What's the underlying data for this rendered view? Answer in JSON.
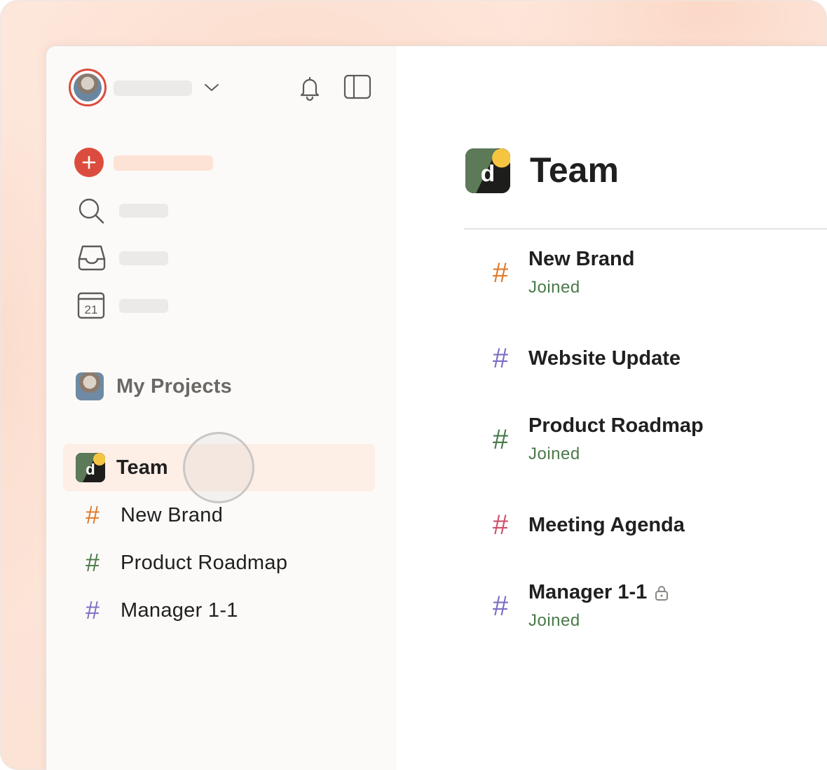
{
  "sidebar": {
    "projects_header": "My Projects",
    "team": {
      "label": "Team"
    },
    "team_projects": [
      {
        "label": "New Brand",
        "color": "#e07a2c"
      },
      {
        "label": "Product Roadmap",
        "color": "#4a7a4a"
      },
      {
        "label": "Manager 1-1",
        "color": "#7c6fc4"
      }
    ],
    "icons": {
      "add": "plus-icon",
      "search": "search-icon",
      "inbox": "inbox-icon",
      "calendar": "calendar-icon",
      "calendar_day": "21",
      "notifications": "bell-icon",
      "toggle_sidebar": "sidebar-toggle-icon"
    },
    "accent": "#dc4c3e"
  },
  "main": {
    "title": "Team",
    "projects": [
      {
        "name": "New Brand",
        "status": "Joined",
        "color": "#e07a2c",
        "locked": false
      },
      {
        "name": "Website Update",
        "status": "",
        "color": "#7c6fc4",
        "locked": false
      },
      {
        "name": "Product Roadmap",
        "status": "Joined",
        "color": "#4a7a4a",
        "locked": false
      },
      {
        "name": "Meeting Agenda",
        "status": "",
        "color": "#d0506a",
        "locked": false
      },
      {
        "name": "Manager 1-1",
        "status": "Joined",
        "color": "#7c6fc4",
        "locked": true
      }
    ]
  }
}
